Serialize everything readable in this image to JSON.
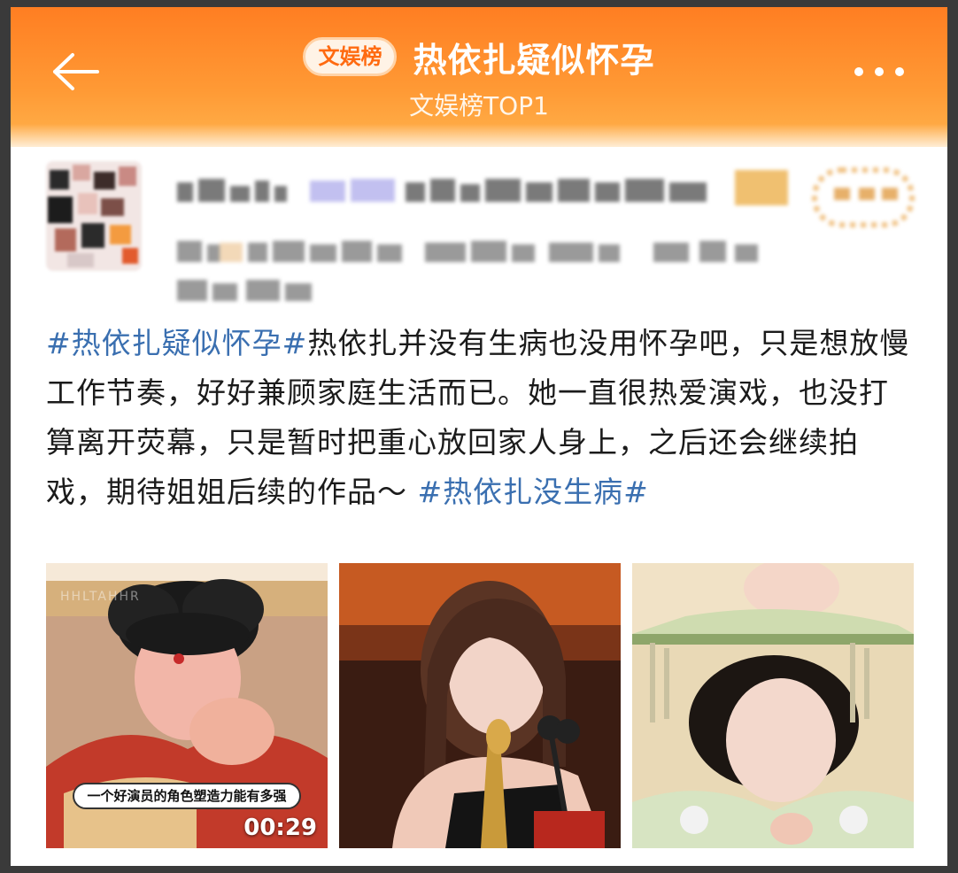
{
  "header": {
    "badge": "文娱榜",
    "title": "热依扎疑似怀孕",
    "subtitle": "文娱榜TOP1",
    "back_icon": "arrow-left-icon",
    "more_icon": "more-dots-icon",
    "gradient_top": "#ff7e22",
    "gradient_bottom": "#ffb34d"
  },
  "post": {
    "topic_1": "#热依扎疑似怀孕#",
    "body": "热依扎并没有生病也没用怀孕吧，只是想放慢工作节奏，好好兼顾家庭生活而已。她一直很热爱演戏，也没打算离开荧幕，只是暂时把重心放回家人身上，之后还会继续拍戏，期待姐姐后续的作品～ ",
    "topic_2": "#热依扎没生病#",
    "link_color": "#3a6fb0"
  },
  "media": {
    "video_caption": "一个好演员的角色塑造力能有多强",
    "video_duration": "00:29",
    "video_watermark": "HHLTAHHR"
  }
}
